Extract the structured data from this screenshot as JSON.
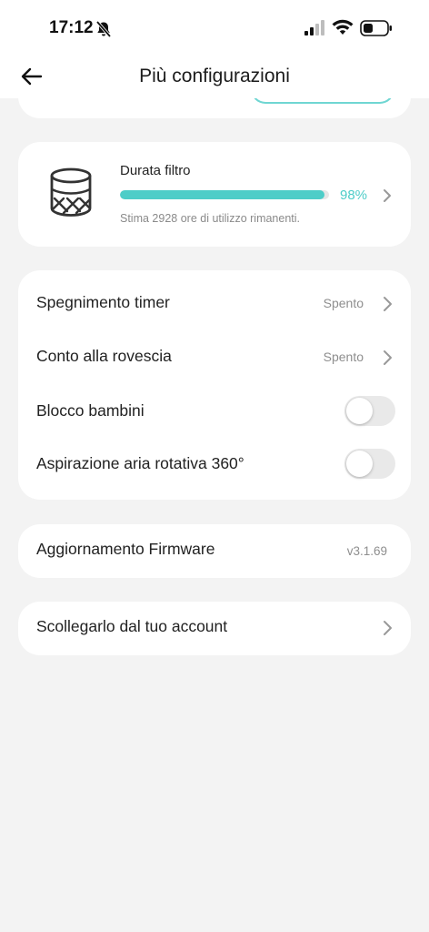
{
  "status_bar": {
    "time": "17:12",
    "icons": [
      "bell-slash-icon",
      "signal-icon",
      "wifi-icon",
      "battery-icon"
    ]
  },
  "header": {
    "title": "Più configurazioni",
    "back_icon": "arrow-left-icon"
  },
  "filter": {
    "label": "Durata filtro",
    "percent_text": "98%",
    "percent_value": 98,
    "estimate": "Stima 2928 ore di utilizzo rimanenti.",
    "icon": "filter-icon"
  },
  "settings": {
    "timer_off": {
      "label": "Spegnimento timer",
      "value": "Spento"
    },
    "countdown": {
      "label": "Conto alla rovescia",
      "value": "Spento"
    },
    "child_lock": {
      "label": "Blocco bambini",
      "enabled": false
    },
    "rotation": {
      "label": "Aspirazione aria rotativa 360°",
      "enabled": false
    }
  },
  "firmware": {
    "label": "Aggiornamento Firmware",
    "version": "v3.1.69"
  },
  "unlink": {
    "label": "Scollegarlo dal tuo account"
  },
  "colors": {
    "accent": "#4ecdc8",
    "background": "#f3f3f3",
    "card": "#ffffff",
    "toggle_off": "#e9e9e9"
  }
}
